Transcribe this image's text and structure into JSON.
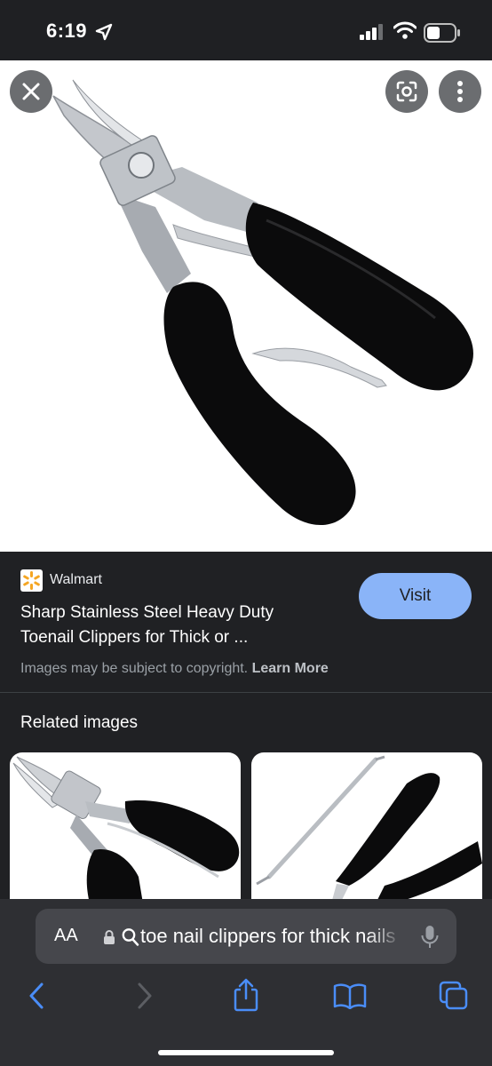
{
  "status_bar": {
    "time": "6:19",
    "icons": [
      "location-arrow-icon",
      "cellular-signal-icon",
      "wifi-icon",
      "battery-icon"
    ]
  },
  "viewer": {
    "buttons": [
      "close-icon",
      "lens-icon",
      "more-vert-icon"
    ],
    "image_subject": "black-handled stainless steel toenail clippers"
  },
  "result": {
    "source": "Walmart",
    "title_line1": "Sharp Stainless Steel Heavy Duty",
    "title_line2": "Toenail Clippers for Thick or ...",
    "visit_label": "Visit",
    "copyright_text": "Images may be subject to copyright.",
    "learn_more": "Learn More",
    "accent_color": "#8ab4f8"
  },
  "related": {
    "title": "Related images"
  },
  "browser": {
    "text_size_label": "AA",
    "url_text": "toe nail clippers for thick nails",
    "nav_icons": [
      "back-icon",
      "forward-icon",
      "share-icon",
      "bookmarks-icon",
      "tabs-icon"
    ],
    "tint_color": "#4a8df8"
  }
}
